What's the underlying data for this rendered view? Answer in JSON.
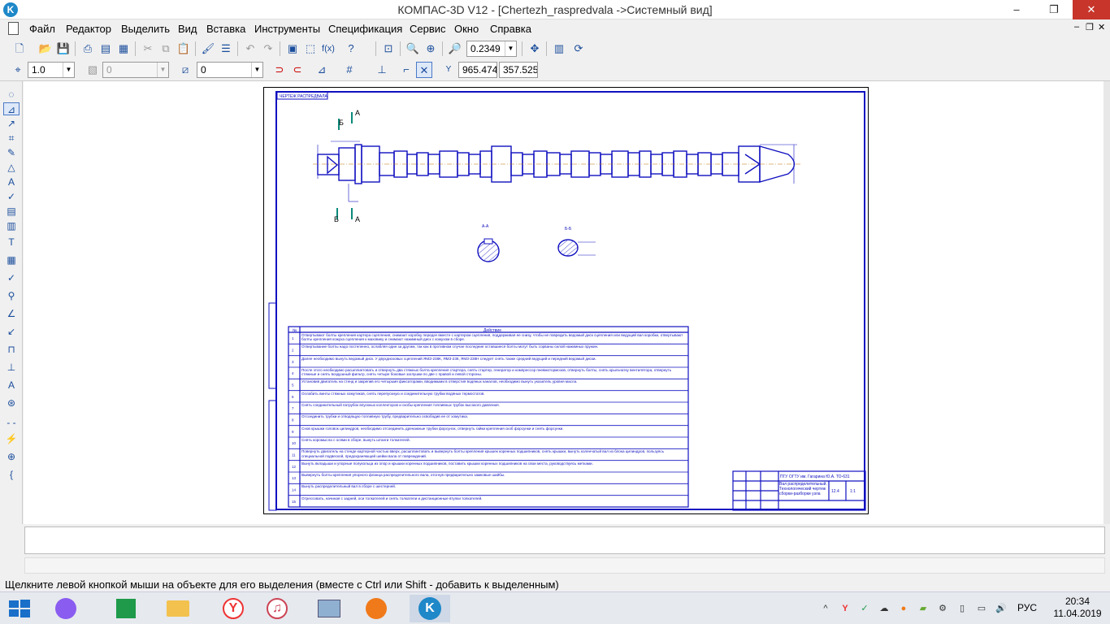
{
  "window": {
    "title": "КОМПАС-3D V12 - [Chertezh_raspredvala ->Системный вид]",
    "minimize": "–",
    "restore": "❐",
    "close": "✕"
  },
  "menu": {
    "items": [
      "Файл",
      "Редактор",
      "Выделить",
      "Вид",
      "Вставка",
      "Инструменты",
      "Спецификация",
      "Сервис",
      "Окно",
      "Справка"
    ],
    "mdi_controls": [
      "–",
      "❐",
      "✕"
    ]
  },
  "toolbar1": {
    "zoom_value": "0.2349",
    "fx_label": "f(x)"
  },
  "toolbar2": {
    "scale_value": "1.0",
    "layer_value": "0",
    "style_value": "0",
    "coord_x": "965.474",
    "coord_y": "357.525"
  },
  "drawing": {
    "title_stamp": "ЧЕРТЕЖ РАСПРЕДВАЛА",
    "section_a": "А",
    "section_b": "Б",
    "section_a_label": "А-А",
    "section_b_label": "Б-Б",
    "table_header_no": "№",
    "table_header_action": "Действие",
    "table_rows": [
      {
        "n": "1",
        "text": "Отвертывают болты крепления картера сцепления, снимают коробку передач вместе с картером сцепления, поддерживая ее снизу, чтобы не повредить ведомый диск сцепления или ведущий вал коробки, отвертывают болты крепления кожуха сцепления к маховику и снимают нажимный диск с кожухом в сборе."
      },
      {
        "n": "2",
        "text": "Отвертывание болты надо постепенно, ослабляя один за другим, так как в противном случае последние оставшиеся болты могут быть сорваны силой нажимных пружин."
      },
      {
        "n": "3",
        "text": "Далее необходимо вынуть ведомый диск. У двухдисковых сцеплений ЯМЗ-238К, ЯМЗ-238, ЯМЗ-238Н следует снять также средний ведущий и передний ведомый диски."
      },
      {
        "n": "4",
        "text": "После этого необходимо расшплинтовать и отвернуть два стяжных болта крепления стартера, снять стартер, генератор и компрессор пневмотормозов, отвернуть болты, снять крыльчатку вентилятора, отвернуть стяжные и снять воздушный фильтр, снять четыре боковые заглушки по две с правой и левой стороны."
      },
      {
        "n": "5",
        "text": "Установив двигатель на стенд и закрепив его четырьмя фиксаторами, вводимыми в отверстия водяных каналов, необходимо вынуть указатель уровня масла."
      },
      {
        "n": "6",
        "text": "Ослабить винты стяжных хомутиков, снять перепускную и соединительную трубки водяных термостатов."
      },
      {
        "n": "7",
        "text": "Снять соединительный патрубок впускных коллекторов и скобы крепления топливных трубок высокого давления."
      },
      {
        "n": "8",
        "text": "Отсоединить трубки и отводящую топливную трубу, предварительно освободив ее от хомутика."
      },
      {
        "n": "9",
        "text": "Снов крышки головок цилиндров, необходимо отсоединить дренажные трубки форсунок, отвернуть гайки крепления скоб форсунки и снять форсунки."
      },
      {
        "n": "10",
        "text": "Снять коромысла с осями в сборе, вынуть штанги толкателей."
      },
      {
        "n": "11",
        "text": "Повернуть двигатель на стенде картерной частью вверх, расшплинтовать и вывернуть болты крепления крышек коренных подшипников, снять крышки, вынуть коленчатый вал из блока цилиндров, пользуясь специальной подвеской, предохраняющей шейки вала от повреждений."
      },
      {
        "n": "12",
        "text": "Вынуть вкладыши и упорные полукольца из опор и крышки коренных подшипников, поставить крышки коренных подшипников на свои места, руководствуясь метками."
      },
      {
        "n": "13",
        "text": "Вывернуть болты крепления упорного фланца распределительного вала, отогнув предварительно замковые шайбы."
      },
      {
        "n": "14",
        "text": "Вынуть распределительный вал в сборе с шестерней."
      },
      {
        "n": "15",
        "text": "Отрессовать, начиная с задней, оси толкателей и снять толкатели и дистанционные втулки толкателей."
      }
    ],
    "stamp_org": "ПГУ ОГТУ им. Гагарина Ю.А. ТО-631",
    "stamp_title": "Вал распределительный. Технологический чертеж сборки-разборки узла",
    "stamp_mass": "12.4",
    "stamp_scale": "1:1"
  },
  "status": {
    "hint": "Щелкните левой кнопкой мыши на объекте для его выделения (вместе с Ctrl или Shift - добавить к выделенным)"
  },
  "taskbar": {
    "lang": "РУС",
    "time": "20:34",
    "date": "11.04.2019"
  }
}
